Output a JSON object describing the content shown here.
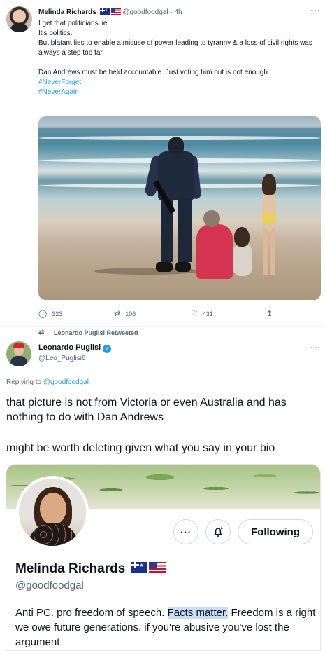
{
  "tweet": {
    "display_name": "Melinda Richards",
    "handle": "@goodfoodgal",
    "separator": "·",
    "time": "4h",
    "more_label": "···",
    "lines": [
      "I get that politicians lie.",
      "It's politics.",
      "But blatant lies to enable a misuse of power leading to tyranny & a loss of civil rights was always a step too far."
    ],
    "line_after_gap": "Dan Andrews must be held accountable. Just voting him out is not enough.",
    "hashtags": [
      "#NeverForget",
      "#NeverAgain"
    ],
    "actions": {
      "replies": "323",
      "retweets": "106",
      "likes": "431"
    },
    "icons": [
      "reply-icon",
      "retweet-icon",
      "like-icon",
      "share-icon"
    ]
  },
  "retweet": {
    "retweeted_by": "Leonardo Puglisi Retweeted",
    "display_name": "Leonardo Puglisi",
    "handle": "@Leo_Puglisi6",
    "more_label": "···",
    "replying_prefix": "Replying to ",
    "replying_to": "@goodfoodgal",
    "body_line1": "that picture is not from Victoria or even Australia and has nothing to do with Dan Andrews",
    "body_line2": "might be worth deleting given what you say in your bio"
  },
  "profile_card": {
    "display_name": "Melinda Richards",
    "handle": "@goodfoodgal",
    "more_label": "···",
    "follow_label": "Following",
    "bio_before": "Anti PC. pro freedom of speech. ",
    "bio_highlight": "Facts matter.",
    "bio_after": " Freedom is a right we owe future generations. if you're abusive you've lost the argument",
    "highlight_color": "#c9dcf6"
  },
  "colors": {
    "text": "#0f1419",
    "secondary": "#536471",
    "link": "#1d9bf0"
  }
}
